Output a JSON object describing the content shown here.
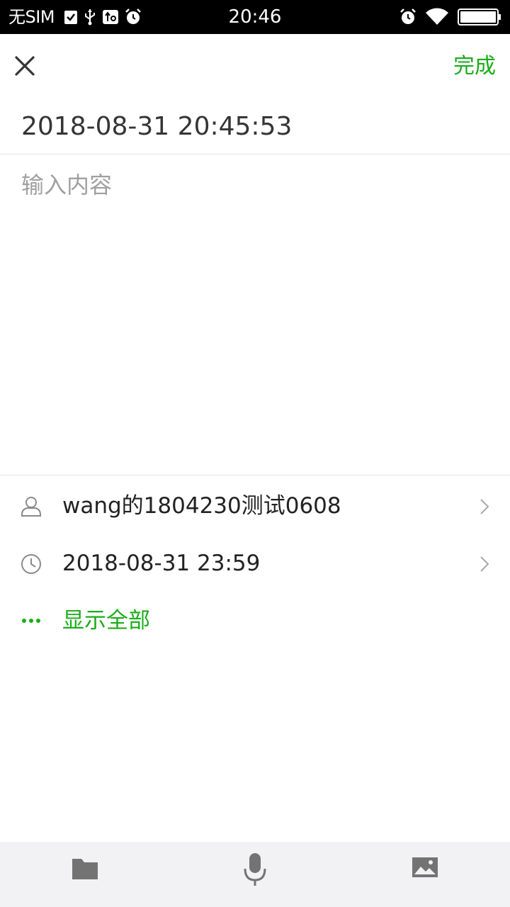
{
  "status_bar": {
    "carrier": "无SIM",
    "time": "20:46",
    "left_icons": [
      "clipboard-check-icon",
      "usb-icon",
      "usb-debug-icon",
      "alarm-icon"
    ],
    "right_icons": [
      "alarm-icon",
      "wifi-icon",
      "battery-icon"
    ]
  },
  "header": {
    "close_icon": "close-icon",
    "done_label": "完成"
  },
  "note": {
    "title": "2018-08-31 20:45:53",
    "content_value": "",
    "content_placeholder": "输入内容"
  },
  "details": {
    "assignee": {
      "icon": "person-icon",
      "label": "wang的1804230测试0608"
    },
    "deadline": {
      "icon": "clock-icon",
      "label": "2018-08-31 23:59"
    },
    "show_all": {
      "icon": "more-dots-icon",
      "label": "显示全部"
    }
  },
  "toolbar": {
    "items": [
      "folder-icon",
      "microphone-icon",
      "image-icon"
    ]
  },
  "colors": {
    "accent": "#1aad19",
    "text": "#353535",
    "placeholder": "#a0a0a0",
    "divider": "#e5e5e5",
    "toolbar_bg": "#f2f2f4",
    "icon_gray": "#737373"
  }
}
